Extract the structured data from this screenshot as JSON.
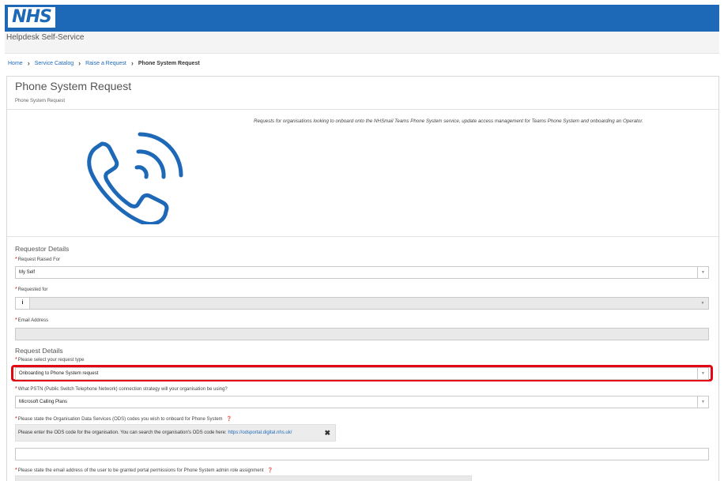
{
  "header": {
    "logo_text": "NHS",
    "app_title": "Helpdesk Self-Service",
    "brand_color": "#1e68b8"
  },
  "breadcrumb": {
    "items": [
      "Home",
      "Service Catalog",
      "Raise a Request"
    ],
    "current": "Phone System Request",
    "separator_icon": "chevron-right-icon"
  },
  "page": {
    "title": "Phone System Request",
    "subtitle": "Phone System Request",
    "description": "Requests for organisations looking to onboard onto the NHSmail Teams Phone System service, update access management for Teams Phone System and onboarding an Operator.",
    "hero_icon": "phone-ringing-icon"
  },
  "requestor": {
    "section_title": "Requestor Details",
    "raised_for_label": "Request Raised For",
    "raised_for_value": "My Self",
    "requested_for_label": "Requested for",
    "requested_for_value": "",
    "email_label": "Email Address",
    "email_value": ""
  },
  "request": {
    "section_title": "Request Details",
    "type_label": "Please select your request type",
    "type_value": "Onboarding to Phone System request",
    "pstn_label": "What PSTN (Public Switch Telephone Network) connection strategy will your organisation be using?",
    "pstn_value": "Microsoft Calling Plans",
    "ods_label": "Please state the Organisation Data Services (ODS) codes you wish to onboard for Phone System",
    "ods_notice": "Please enter the ODS code for the organisation. You can search the organisation's ODS code here: ",
    "ods_link": "https://odsportal.digital.nhs.uk/",
    "ods_value": "",
    "email_perm_label": "Please state the email address of the user to be granted portal permissions for Phone System admin role assignment"
  },
  "colors": {
    "highlight": "#e30613",
    "required": "#cc0000",
    "link": "#1e68b8"
  }
}
